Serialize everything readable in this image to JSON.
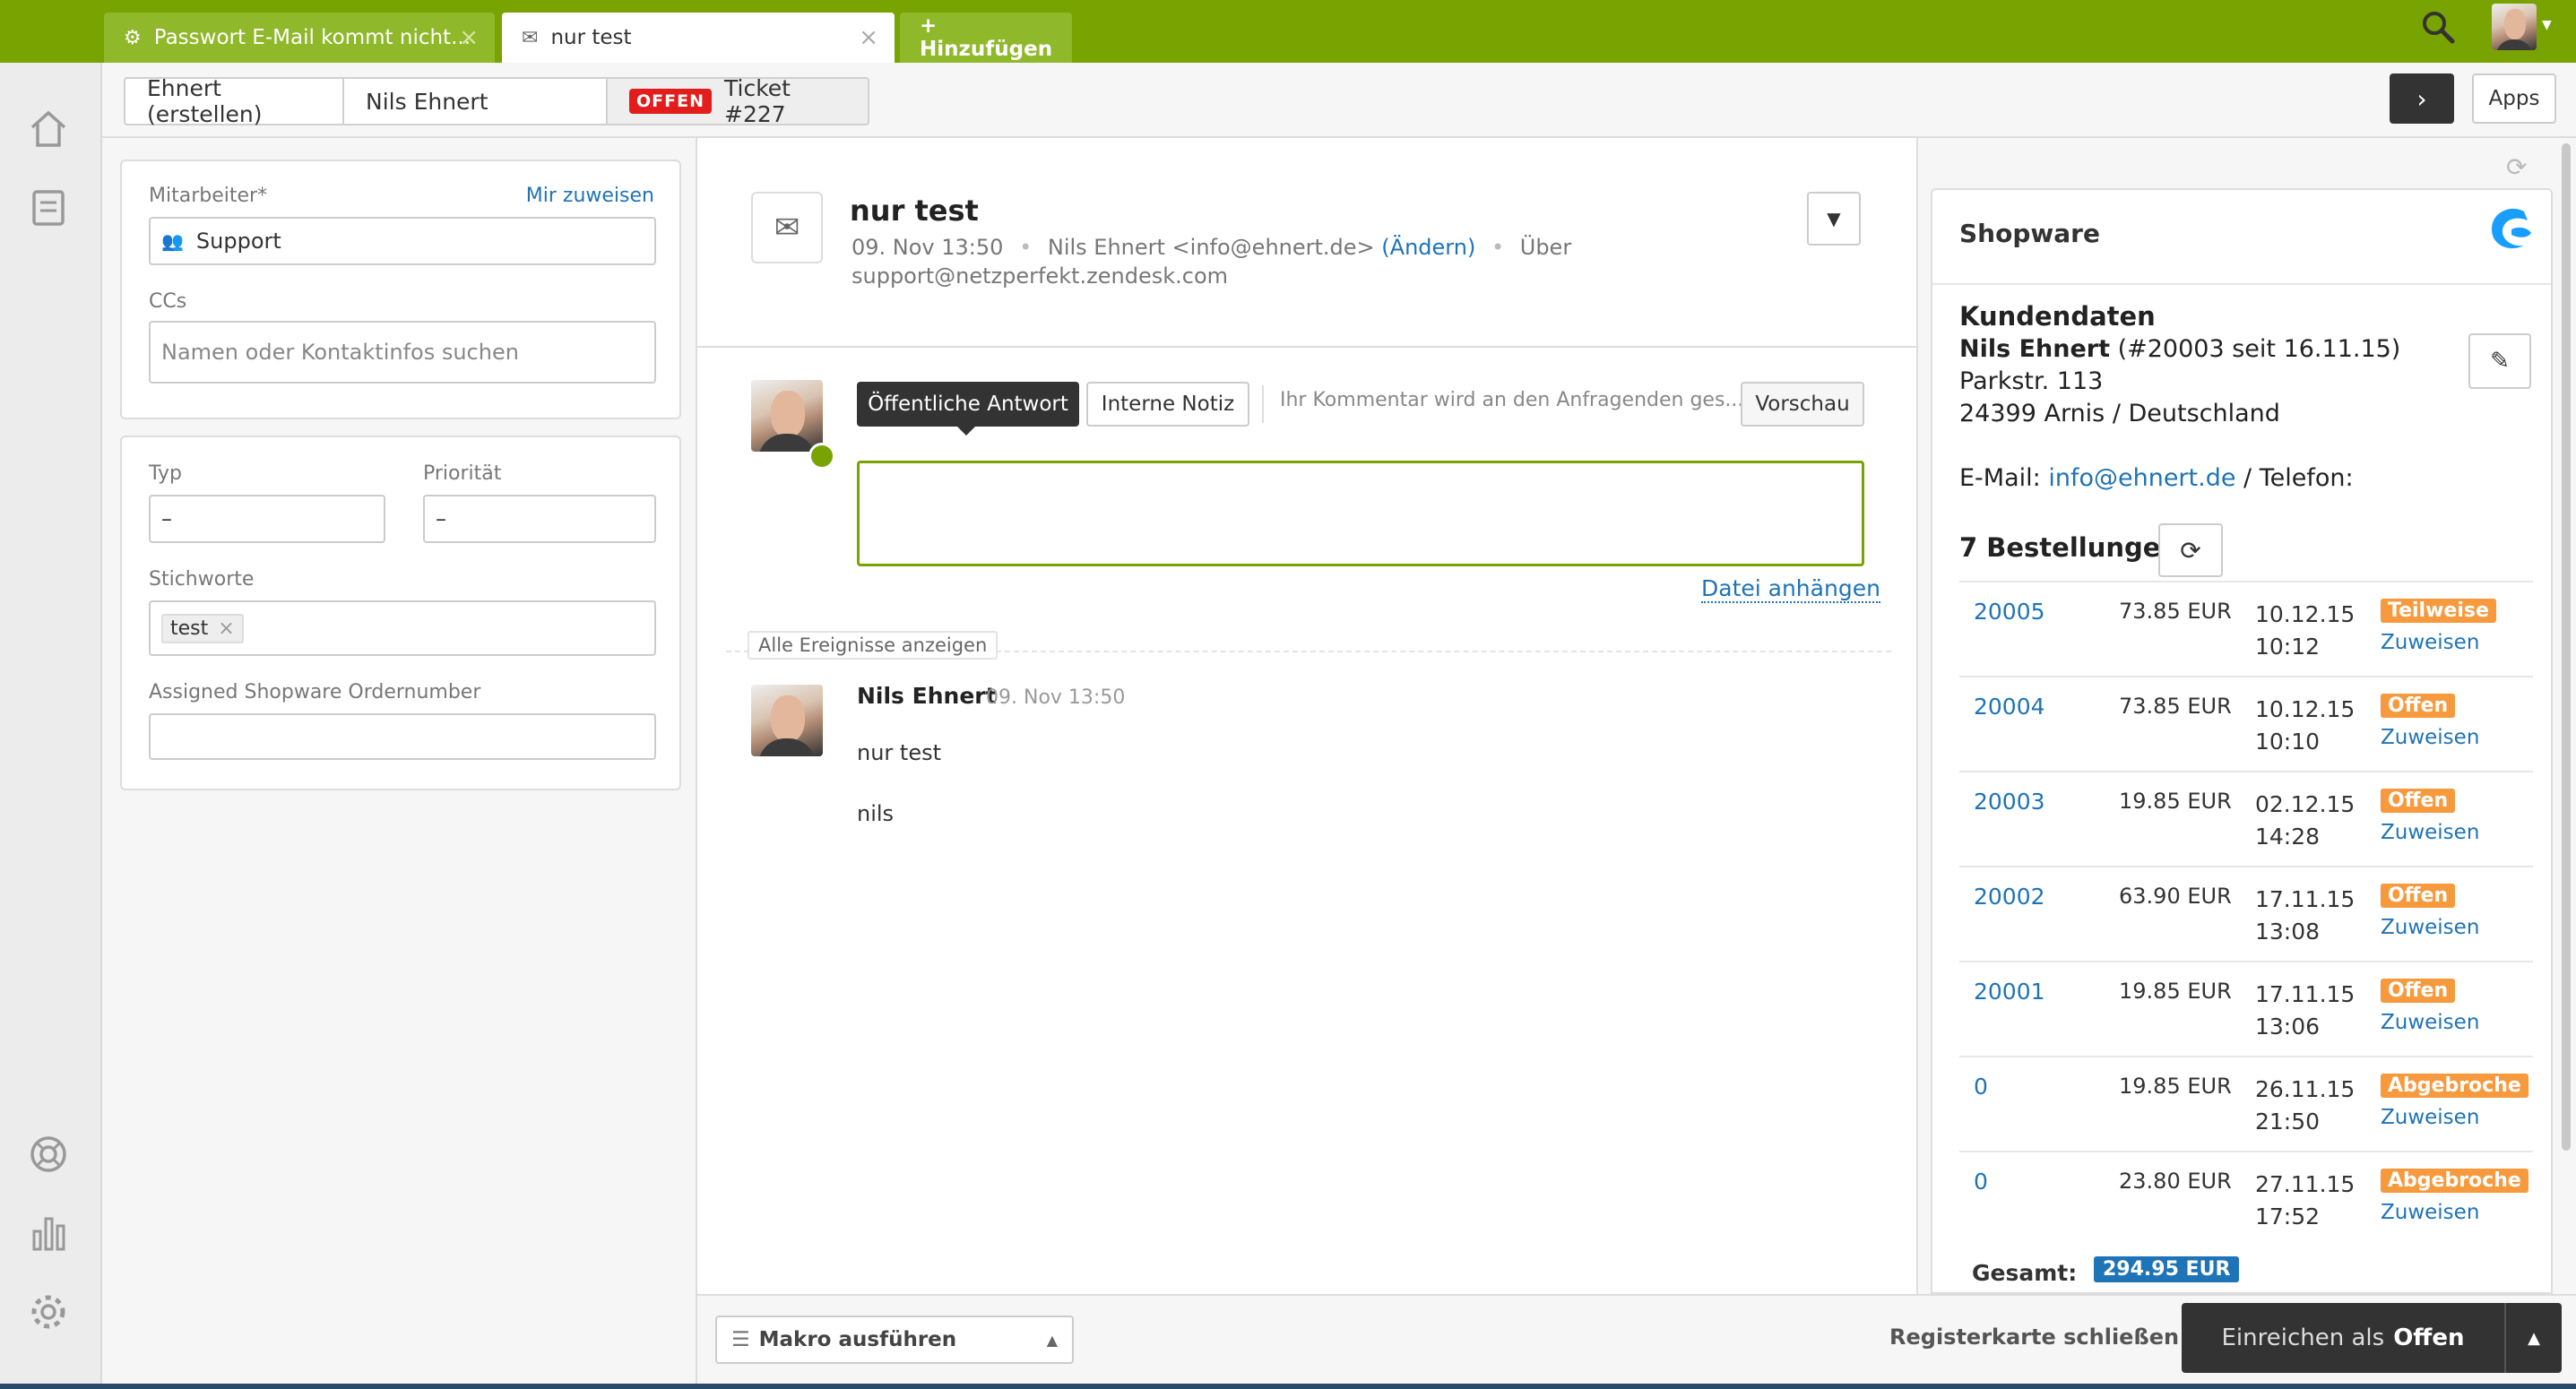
{
  "tabs": [
    {
      "label": "Passwort E-Mail kommt nicht...",
      "icon": "gear-icon"
    },
    {
      "label": "nur test",
      "icon": "envelope-icon"
    },
    {
      "label": "+ Hinzufügen"
    }
  ],
  "breadcrumbs": {
    "org": "Ehnert (erstellen)",
    "user": "Nils Ehnert",
    "status_badge": "OFFEN",
    "ticket": "Ticket #227"
  },
  "header_buttons": {
    "apps": "Apps"
  },
  "ticket_fields": {
    "assignee_label": "Mitarbeiter*",
    "assign_me": "Mir zuweisen",
    "assignee_value": "Support",
    "ccs_label": "CCs",
    "ccs_placeholder": "Namen oder Kontaktinfos suchen",
    "type_label": "Typ",
    "type_value": "–",
    "priority_label": "Priorität",
    "priority_value": "–",
    "tags_label": "Stichworte",
    "tag": "test",
    "custom_label": "Assigned Shopware Ordernumber",
    "custom_value": ""
  },
  "conversation": {
    "title": "nur test",
    "date": "09. Nov 13:50",
    "from": "Nils Ehnert <info@ehnert.de>",
    "change": "(Ändern)",
    "via": "Über",
    "via_address": "support@netzperfekt.zendesk.com",
    "public_reply": "Öffentliche Antwort",
    "internal_note": "Interne Notiz",
    "hint": "Ihr Kommentar wird an den Anfragenden ges...",
    "preview": "Vorschau",
    "attach": "Datei anhängen",
    "all_events": "Alle Ereignisse anzeigen",
    "comment_author": "Nils Ehnert",
    "comment_date": "09. Nov 13:50",
    "comment_line1": "nur test",
    "comment_line2": "nils"
  },
  "footer": {
    "macro": "Makro ausführen",
    "close_tab": "Registerkarte schließen",
    "submit_prefix": "Einreichen als",
    "submit_status": "Offen"
  },
  "shopware": {
    "title": "Shopware",
    "customer_heading": "Kundendaten",
    "customer_name": "Nils Ehnert",
    "customer_meta": "(#20003 seit 16.11.15)",
    "street": "Parkstr. 113",
    "city": "24399 Arnis / Deutschland",
    "email_label": "E-Mail:",
    "email": "info@ehnert.de",
    "phone_label": "/ Telefon:",
    "orders_heading": "7 Bestellungen",
    "orders": [
      {
        "number": "20005",
        "amount": "73.85 EUR",
        "date": "10.12.15",
        "time": "10:12",
        "status": "Teilweise",
        "assign": "Zuweisen"
      },
      {
        "number": "20004",
        "amount": "73.85 EUR",
        "date": "10.12.15",
        "time": "10:10",
        "status": "Offen",
        "assign": "Zuweisen"
      },
      {
        "number": "20003",
        "amount": "19.85 EUR",
        "date": "02.12.15",
        "time": "14:28",
        "status": "Offen",
        "assign": "Zuweisen"
      },
      {
        "number": "20002",
        "amount": "63.90 EUR",
        "date": "17.11.15",
        "time": "13:08",
        "status": "Offen",
        "assign": "Zuweisen"
      },
      {
        "number": "20001",
        "amount": "19.85 EUR",
        "date": "17.11.15",
        "time": "13:06",
        "status": "Offen",
        "assign": "Zuweisen"
      },
      {
        "number": "0",
        "amount": "19.85 EUR",
        "date": "26.11.15",
        "time": "21:50",
        "status": "Abgebroche",
        "assign": "Zuweisen"
      },
      {
        "number": "0",
        "amount": "23.80 EUR",
        "date": "27.11.15",
        "time": "17:52",
        "status": "Abgebroche",
        "assign": "Zuweisen"
      }
    ],
    "total_label": "Gesamt:",
    "total_value": "294.95 EUR"
  },
  "colors": {
    "brand_green": "#78a300",
    "link_blue": "#1f73b7",
    "status_orange": "#f79a3e",
    "badge_red": "#e31c1c"
  }
}
